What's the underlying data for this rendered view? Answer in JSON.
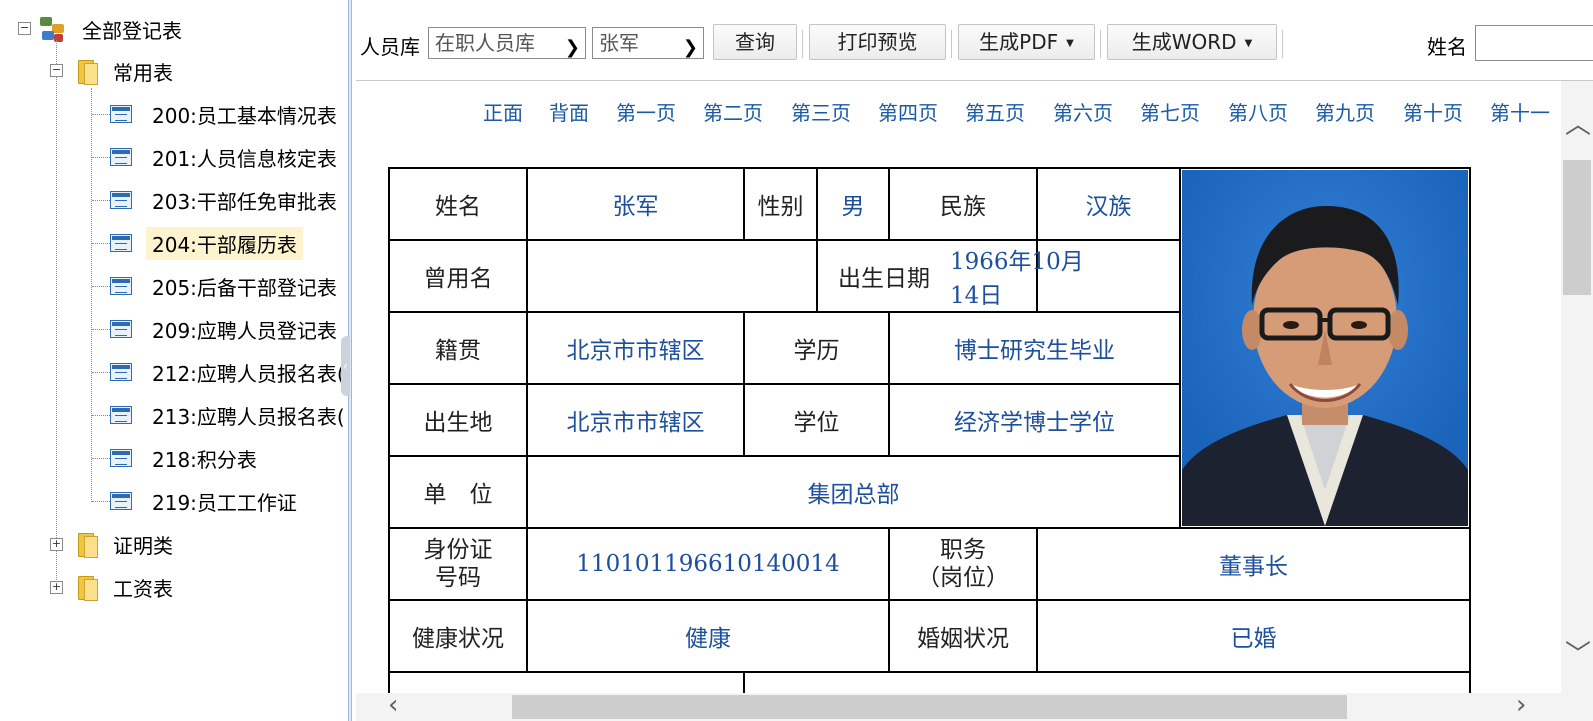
{
  "tree": {
    "root": "全部登记表",
    "groups": [
      {
        "label": "常用表",
        "items": [
          "200:员工基本情况表",
          "201:人员信息核定表",
          "203:干部任免审批表",
          "204:干部履历表",
          "205:后备干部登记表",
          "209:应聘人员登记表",
          "212:应聘人员报名表(",
          "213:应聘人员报名表(",
          "218:积分表",
          "219:员工工作证"
        ],
        "selected": "204:干部履历表"
      },
      {
        "label": "证明类"
      },
      {
        "label": "工资表"
      }
    ]
  },
  "toolbar": {
    "library_label": "人员库",
    "library_value": "在职人员库",
    "person_value": "张军",
    "query": "查询",
    "print_preview": "打印预览",
    "gen_pdf": "生成PDF",
    "gen_word": "生成WORD",
    "name_label": "姓名",
    "name_value": ""
  },
  "pages": [
    "正面",
    "背面",
    "第一页",
    "第二页",
    "第三页",
    "第四页",
    "第五页",
    "第六页",
    "第七页",
    "第八页",
    "第九页",
    "第十页",
    "第十一"
  ],
  "form": {
    "name_label": "姓名",
    "name": "张军",
    "gender_label": "性别",
    "gender": "男",
    "ethnicity_label": "民族",
    "ethnicity": "汉族",
    "former_name_label": "曾用名",
    "former_name": "",
    "birth_label": "出生日期",
    "birth": "1966年10月14日",
    "native_label": "籍贯",
    "native": "北京市市辖区",
    "education_label": "学历",
    "education": "博士研究生毕业",
    "birthplace_label": "出生地",
    "birthplace": "北京市市辖区",
    "degree_label": "学位",
    "degree": "经济学博士学位",
    "unit_label": "单　位",
    "unit": "集团总部",
    "id_label_1": "身份证",
    "id_label_2": "号码",
    "id": "110101196610140014",
    "post_label_1": "职务",
    "post_label_2": "（岗位）",
    "post": "董事长",
    "health_label": "健康状况",
    "health": "健康",
    "marital_label": "婚姻状况",
    "marital": "已婚"
  },
  "colors": {
    "value_text": "#1d4f9c",
    "link": "#1a5aa6",
    "selected_bg": "#fdf3cf",
    "photo_bg": "#1f6fc9"
  }
}
